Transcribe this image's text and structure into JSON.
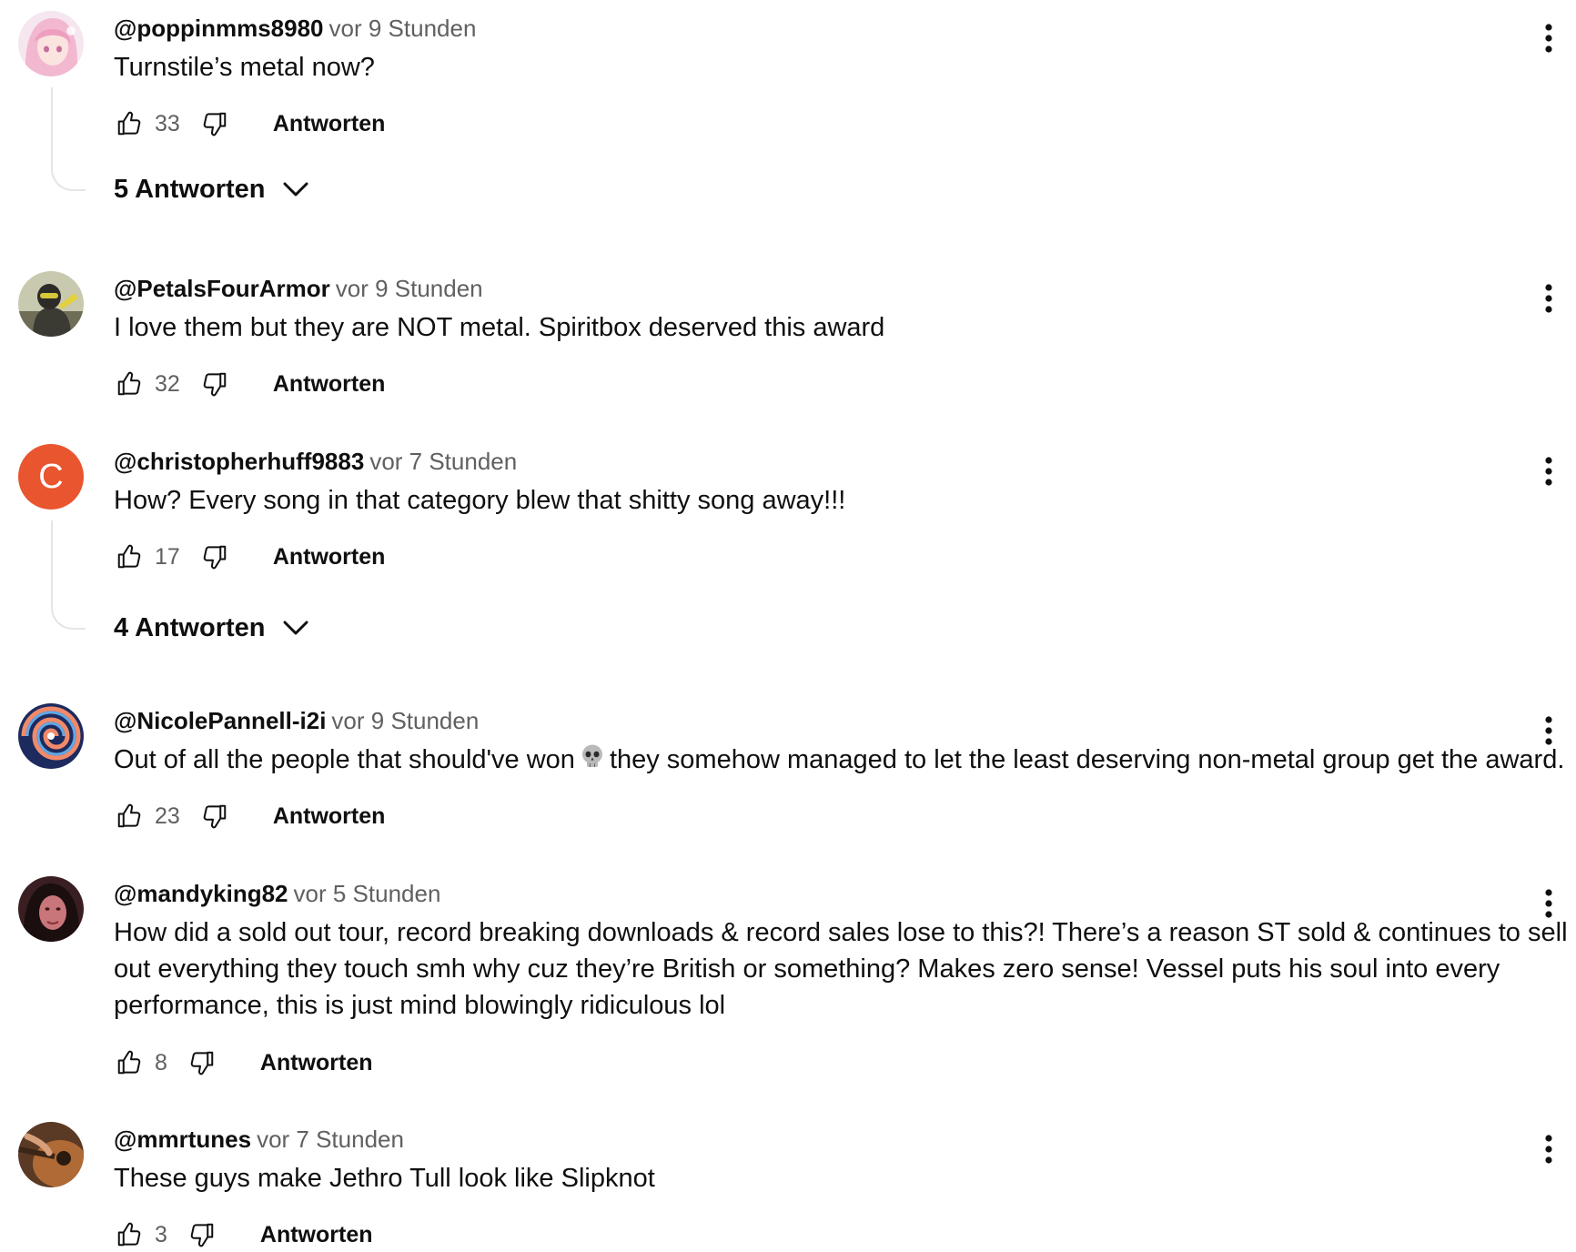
{
  "labels": {
    "reply": "Antworten"
  },
  "comments": [
    {
      "author": "@poppinmms8980",
      "time": "vor 9 Stunden",
      "text": "Turnstile’s metal now?",
      "likes": "33",
      "replies_label": "5 Antworten",
      "avatar": "pink-haired-anime-avatar"
    },
    {
      "author": "@PetalsFourArmor",
      "time": "vor 9 Stunden",
      "text": "I love them but they are NOT metal. Spiritbox deserved this award",
      "likes": "32",
      "avatar": "helmeted-figure-avatar"
    },
    {
      "author": "@christopherhuff9883",
      "time": "vor 7 Stunden",
      "text": "How? Every song in that category blew that shitty song away!!!",
      "likes": "17",
      "replies_label": "4 Antworten",
      "avatar_letter": "C",
      "avatar_color": "#e8552f"
    },
    {
      "author": "@NicolePannell-i2i",
      "time": "vor 9 Stunden",
      "text_before": "Out of all the people that should've won",
      "text_after": "they somehow managed to let the least deserving non-metal group get the award.",
      "emoji": "skull-emoji",
      "likes": "23",
      "avatar": "swirl-avatar"
    },
    {
      "author": "@mandyking82",
      "time": "vor 5 Stunden",
      "text": "How did a sold out tour, record breaking downloads & record sales lose to this?! There’s a reason ST sold & continues to sell out everything they touch smh why cuz they’re British or something? Makes zero sense! Vessel puts his soul into every performance, this is just mind blowingly ridiculous lol",
      "likes": "8",
      "avatar": "dark-haired-woman-avatar"
    },
    {
      "author": "@mmrtunes",
      "time": "vor 7 Stunden",
      "text": "These guys make Jethro Tull look like Slipknot",
      "likes": "3",
      "avatar": "guitar-avatar"
    }
  ],
  "colors": {
    "text": "#0f0f0f",
    "secondary": "#606060",
    "thread_line": "#e5e5e5"
  }
}
